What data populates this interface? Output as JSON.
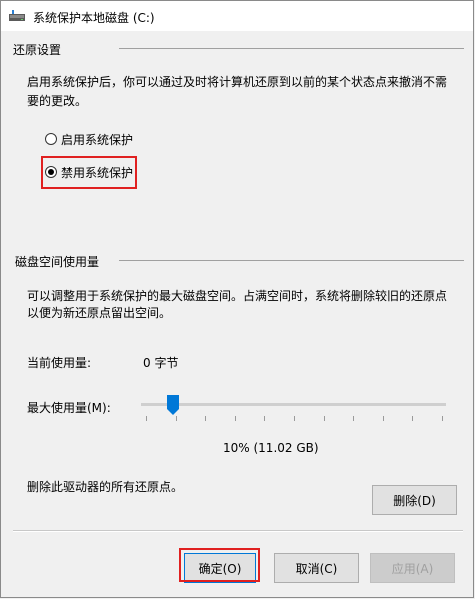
{
  "window": {
    "title": "系统保护本地磁盘 (C:)",
    "icon": "drive-icon"
  },
  "restore": {
    "group_title": "还原设置",
    "description_line1": "启用系统保护后，你可以通过及时将计算机还原到以前的某个状态点来撤消不需",
    "description_line2": "要的更改。",
    "options": [
      {
        "label": "启用系统保护",
        "checked": false
      },
      {
        "label": "禁用系统保护",
        "checked": true
      }
    ]
  },
  "disk": {
    "group_title": "磁盘空间使用量",
    "description_line1": "可以调整用于系统保护的最大磁盘空间。占满空间时，系统将删除较旧的还原点",
    "description_line2": "以便为新还原点留出空间。",
    "current_label": "当前使用量:",
    "current_value": "0 字节",
    "max_label": "最大使用量(M):",
    "slider_percent": 10,
    "slider_readout": "10% (11.02 GB)",
    "delete_text": "删除此驱动器的所有还原点。",
    "delete_button": "删除(D)"
  },
  "footer": {
    "ok": "确定(O)",
    "cancel": "取消(C)",
    "apply": "应用(A)"
  },
  "colors": {
    "highlight": "#e02020",
    "default_button_border": "#0078d7"
  }
}
